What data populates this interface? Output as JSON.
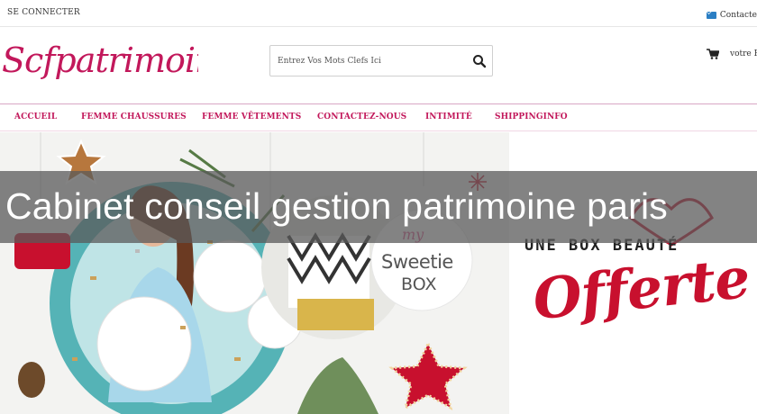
{
  "topbar": {
    "login_label": "SE CONNECTER",
    "contact_label": "Contacte"
  },
  "header": {
    "logo_text": "Scfpatrimoine",
    "search_placeholder": "Entrez Vos Mots Clefs Ici",
    "cart_label": "votre P"
  },
  "nav": {
    "items": [
      {
        "label": "ACCUEIL"
      },
      {
        "label": "FEMME CHAUSSURES"
      },
      {
        "label": "FEMME VÊTEMENTS"
      },
      {
        "label": "CONTACTEZ-NOUS"
      },
      {
        "label": "INTIMITÉ"
      },
      {
        "label": "SHIPPINGINFO"
      }
    ]
  },
  "banner": {
    "box_tagline": "UNE BOX BEAUTÉ",
    "offer_word": "Offerte",
    "sweetie_my": "my",
    "sweetie_name": "Sweetie",
    "sweetie_box": "BOX"
  },
  "overlay": {
    "title": "Cabinet conseil gestion patrimoine paris"
  },
  "colors": {
    "brand_pink": "#c2185b",
    "offer_red": "#c8102e",
    "contact_blue": "#2b7fc4"
  }
}
